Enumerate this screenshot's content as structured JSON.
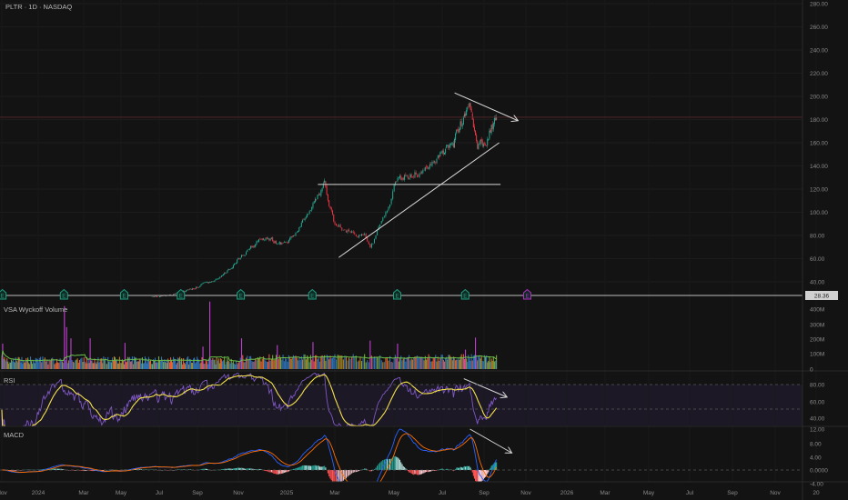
{
  "header": {
    "symbol_line": "PLTR · 1D · NASDAQ"
  },
  "panels": {
    "volume_label": "VSA Wyckoff Volume",
    "rsi_label": "RSI",
    "macd_label": "MACD"
  },
  "colors": {
    "background": "#131313",
    "candle_up": "#22ab94",
    "candle_down": "#f23645",
    "rsi_line": "#7e57c2",
    "rsi_ma": "#f5e34a",
    "macd_line": "#2962ff",
    "signal_line": "#ff6d00",
    "volume_ma": "#6abf4b",
    "volume_spike": "#c040d0",
    "earnings_marker": "#1e9e7e",
    "earnings_future": "#b030c0"
  },
  "chart_data": {
    "type": "candlestick",
    "title": "PLTR · 1D · NASDAQ",
    "price_axis": {
      "min": 40,
      "max": 280,
      "tick_labels": [
        "280.00",
        "260.00",
        "240.00",
        "220.00",
        "200.00",
        "180.00",
        "160.00",
        "140.00",
        "120.00",
        "100.00",
        "80.00",
        "60.00",
        "40.00"
      ]
    },
    "price_label": "28.36",
    "time_axis": {
      "tick_labels": [
        "Nov",
        "2024",
        "Mar",
        "May",
        "Jul",
        "Sep",
        "Nov",
        "2025",
        "Mar",
        "May",
        "Jul",
        "Sep",
        "Nov",
        "2026",
        "Mar",
        "May",
        "Jul",
        "Sep",
        "Nov",
        "20"
      ]
    },
    "close_keypoints": [
      {
        "date": "2023-11-01",
        "close": 20
      },
      {
        "date": "2023-12-01",
        "close": 17
      },
      {
        "date": "2024-01-01",
        "close": 17
      },
      {
        "date": "2024-02-01",
        "close": 24
      },
      {
        "date": "2024-03-01",
        "close": 24
      },
      {
        "date": "2024-04-01",
        "close": 22
      },
      {
        "date": "2024-05-01",
        "close": 21
      },
      {
        "date": "2024-06-01",
        "close": 25
      },
      {
        "date": "2024-07-01",
        "close": 27
      },
      {
        "date": "2024-08-01",
        "close": 30
      },
      {
        "date": "2024-09-01",
        "close": 36
      },
      {
        "date": "2024-10-01",
        "close": 42
      },
      {
        "date": "2024-11-01",
        "close": 60
      },
      {
        "date": "2024-12-01",
        "close": 78
      },
      {
        "date": "2025-01-01",
        "close": 72
      },
      {
        "date": "2025-01-15",
        "close": 85
      },
      {
        "date": "2025-02-01",
        "close": 105
      },
      {
        "date": "2025-02-19",
        "close": 124
      },
      {
        "date": "2025-03-01",
        "close": 90
      },
      {
        "date": "2025-03-15",
        "close": 84
      },
      {
        "date": "2025-04-01",
        "close": 80
      },
      {
        "date": "2025-04-07",
        "close": 70
      },
      {
        "date": "2025-05-01",
        "close": 120
      },
      {
        "date": "2025-05-06",
        "close": 128
      },
      {
        "date": "2025-06-01",
        "close": 135
      },
      {
        "date": "2025-06-15",
        "close": 140
      },
      {
        "date": "2025-07-01",
        "close": 150
      },
      {
        "date": "2025-07-18",
        "close": 160
      },
      {
        "date": "2025-08-01",
        "close": 180
      },
      {
        "date": "2025-08-12",
        "close": 188
      },
      {
        "date": "2025-08-21",
        "close": 155
      },
      {
        "date": "2025-09-01",
        "close": 160
      },
      {
        "date": "2025-09-19",
        "close": 182
      }
    ],
    "volume_axis": {
      "tick_labels": [
        "400M",
        "300M",
        "200M",
        "100M",
        "0"
      ],
      "max": 400000000
    },
    "volume_spikes": [
      {
        "date": "2023-11-03",
        "volume": 170000000
      },
      {
        "date": "2024-02-06",
        "volume": 420000000
      },
      {
        "date": "2024-02-09",
        "volume": 280000000
      },
      {
        "date": "2024-02-14",
        "volume": 205000000
      },
      {
        "date": "2024-03-11",
        "volume": 205000000
      },
      {
        "date": "2024-05-07",
        "volume": 175000000
      },
      {
        "date": "2024-09-09",
        "volume": 150000000
      },
      {
        "date": "2024-09-20",
        "volume": 450000000
      },
      {
        "date": "2024-11-05",
        "volume": 205000000
      },
      {
        "date": "2024-12-20",
        "volume": 160000000
      },
      {
        "date": "2025-02-04",
        "volume": 180000000
      },
      {
        "date": "2025-04-07",
        "volume": 190000000
      },
      {
        "date": "2025-05-06",
        "volume": 170000000
      },
      {
        "date": "2025-08-05",
        "volume": 130000000
      },
      {
        "date": "2025-08-19",
        "volume": 210000000
      }
    ],
    "rsi_axis": {
      "tick_labels": [
        "80.00",
        "60.00",
        "40.00"
      ],
      "band": [
        30,
        70
      ]
    },
    "macd_axis": {
      "tick_labels": [
        "12.00",
        "8.00",
        "4.00",
        "0.0000",
        "-4.00"
      ]
    },
    "earnings_dates": [
      "2023-11-02",
      "2024-02-05",
      "2024-05-06",
      "2024-08-05",
      "2024-11-04",
      "2025-02-03",
      "2025-05-05",
      "2025-08-04"
    ],
    "earnings_upcoming": [
      "2025-11-03"
    ],
    "earnings_marker_label": "E",
    "drawings": [
      {
        "kind": "horizontal",
        "price": 124,
        "from": "2025-02-10",
        "to": "2025-09-25"
      },
      {
        "kind": "trendline",
        "from": {
          "date": "2025-03-05",
          "price": 61
        },
        "to": {
          "date": "2025-09-23",
          "price": 160
        }
      },
      {
        "kind": "arrow",
        "panel": "price",
        "from": {
          "date": "2025-07-19",
          "price": 203
        },
        "to": {
          "date": "2025-10-20",
          "price": 179
        }
      },
      {
        "kind": "arrow",
        "panel": "rsi",
        "from": {
          "date": "2025-08-02",
          "value": 87
        },
        "to": {
          "date": "2025-10-04",
          "value": 65
        }
      },
      {
        "kind": "arrow",
        "panel": "macd",
        "from": {
          "date": "2025-08-11",
          "value": 12
        },
        "to": {
          "date": "2025-10-11",
          "value": 5
        }
      }
    ],
    "grid": true
  }
}
